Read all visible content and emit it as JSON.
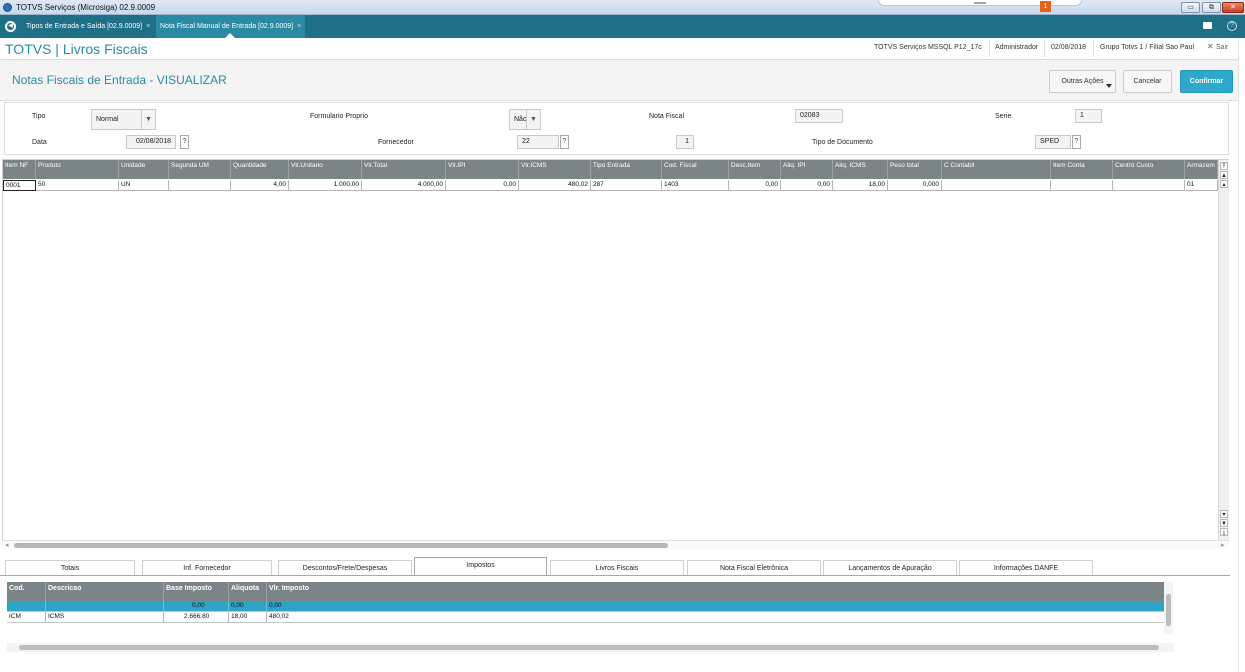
{
  "window": {
    "title": "TOTVS Serviços (Microsiga) 02.9.0009",
    "notification_count": "1",
    "min": "▭",
    "restore": "⧉",
    "close": "✕"
  },
  "tabs": [
    {
      "label": "Tipos de Entrada e Saída [02.9.0009]",
      "close": "×"
    },
    {
      "label": "Nota Fiscal Manual de Entrada [02.9.0009]",
      "close": "×"
    }
  ],
  "header": {
    "brand": "TOTVS | Livros Fiscais",
    "server": "TOTVS Serviços MSSQL P12_17c",
    "user": "Administrador",
    "date": "02/08/2018",
    "company": "Grupo Totvs 1 / Filial Sao Paul",
    "exit": "Sair"
  },
  "page": {
    "title": "Notas Fiscais de Entrada - VISUALIZAR"
  },
  "actions": {
    "more": "Outras Ações",
    "cancel": "Cancelar",
    "confirm": "Confirmar"
  },
  "form": {
    "tipo_label": "Tipo",
    "tipo_value": "Normal",
    "formulario_label": "Formulario Proprio",
    "formulario_value": "Não",
    "nota_label": "Nota Fiscal",
    "nota_value": "02083",
    "serie_label": "Serie",
    "serie_value": "1",
    "data_label": "Data",
    "data_value": "02/08/2018",
    "fornecedor_label": "Fornecedor",
    "fornecedor_value": "22",
    "loja_value": "1",
    "tipodoc_label": "Tipo de Documento",
    "tipodoc_value": "SPED",
    "lookup": "?"
  },
  "grid": {
    "columns": [
      "Item NF",
      "Produto",
      "Unidade",
      "Segunda UM",
      "Quantidade",
      "Vlr.Unitario",
      "Vlr.Total",
      "Vlr.IPI",
      "Vlr.ICMS",
      "Tipo Entrada",
      "Cod. Fiscal",
      "Desc.Item",
      "Aliq. IPI",
      "Aliq. ICMS",
      "Peso total",
      "C Contabil",
      "Item Conta",
      "Centro Custo",
      "Armazem"
    ],
    "rows": [
      [
        "0001",
        "50",
        "UN",
        "",
        "4,00",
        "1.000,00",
        "4.000,00",
        "0,00",
        "480,02",
        "287",
        "1403",
        "0,00",
        "0,00",
        "18,00",
        "0,000",
        "",
        "",
        "",
        "01"
      ]
    ]
  },
  "folder_tabs": [
    "Totais",
    "Inf. Fornecedor",
    "Descontos/Frete/Despesas",
    "Impostos",
    "Livros Fiscais",
    "Nota Fiscal Eletrônica",
    "Lançamentos de Apuração",
    "Informações DANFE"
  ],
  "active_tab": "Impostos",
  "taxes": {
    "columns": [
      "Cod.",
      "Descricao",
      "Base Imposto",
      "Aliquota",
      "Vlr. Imposto"
    ],
    "rows": [
      [
        "",
        "",
        "0,00",
        "0,00",
        "0,00"
      ],
      [
        "ICM",
        "ICMS",
        "2.666,80",
        "18,00",
        "480,02"
      ]
    ]
  }
}
